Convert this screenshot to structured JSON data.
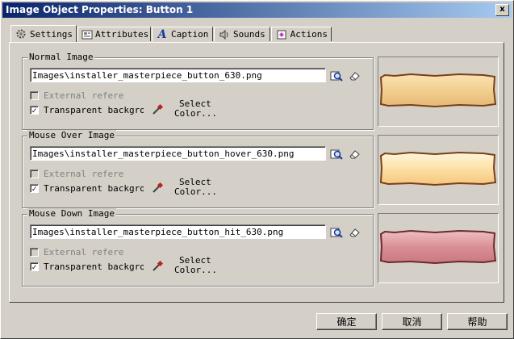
{
  "window": {
    "title": "Image Object Properties: Button 1",
    "close_glyph": "x"
  },
  "tabs": [
    {
      "label": "Settings",
      "icon": "gear-icon"
    },
    {
      "label": "Attributes",
      "icon": "attributes-icon"
    },
    {
      "label": "Caption",
      "icon": "caption-a-icon"
    },
    {
      "label": "Sounds",
      "icon": "speaker-icon"
    },
    {
      "label": "Actions",
      "icon": "actions-icon"
    }
  ],
  "groups": [
    {
      "label": "Normal Image",
      "path": "Images\\installer_masterpiece_button_630.png",
      "external_label": "External referen",
      "external_checked": false,
      "transparent_label": "Transparent backgrou",
      "transparent_checked": true,
      "select_color_line1": "Select",
      "select_color_line2": "Color...",
      "preview_colors": [
        "#fbe3b4",
        "#f2cf8e",
        "#c88b41"
      ]
    },
    {
      "label": "Mouse Over Image",
      "path": "Images\\installer_masterpiece_button_hover_630.png",
      "external_label": "External referen",
      "external_checked": false,
      "transparent_label": "Transparent backgrou",
      "transparent_checked": true,
      "select_color_line1": "Select",
      "select_color_line2": "Color...",
      "preview_colors": [
        "#fff2d0",
        "#fde0a5",
        "#d89a52"
      ]
    },
    {
      "label": "Mouse Down Image",
      "path": "Images\\installer_masterpiece_button_hit_630.png",
      "external_label": "External referen",
      "external_checked": false,
      "transparent_label": "Transparent backgrou",
      "transparent_checked": true,
      "select_color_line1": "Select",
      "select_color_line2": "Color...",
      "preview_colors": [
        "#e8aeb0",
        "#d98f95",
        "#9a4a4f"
      ]
    }
  ],
  "buttons": {
    "ok": "确定",
    "cancel": "取消",
    "help": "帮助"
  },
  "colors": {
    "titlebar_start": "#0a246a",
    "titlebar_end": "#a6caf0",
    "face": "#d4d0c8"
  }
}
